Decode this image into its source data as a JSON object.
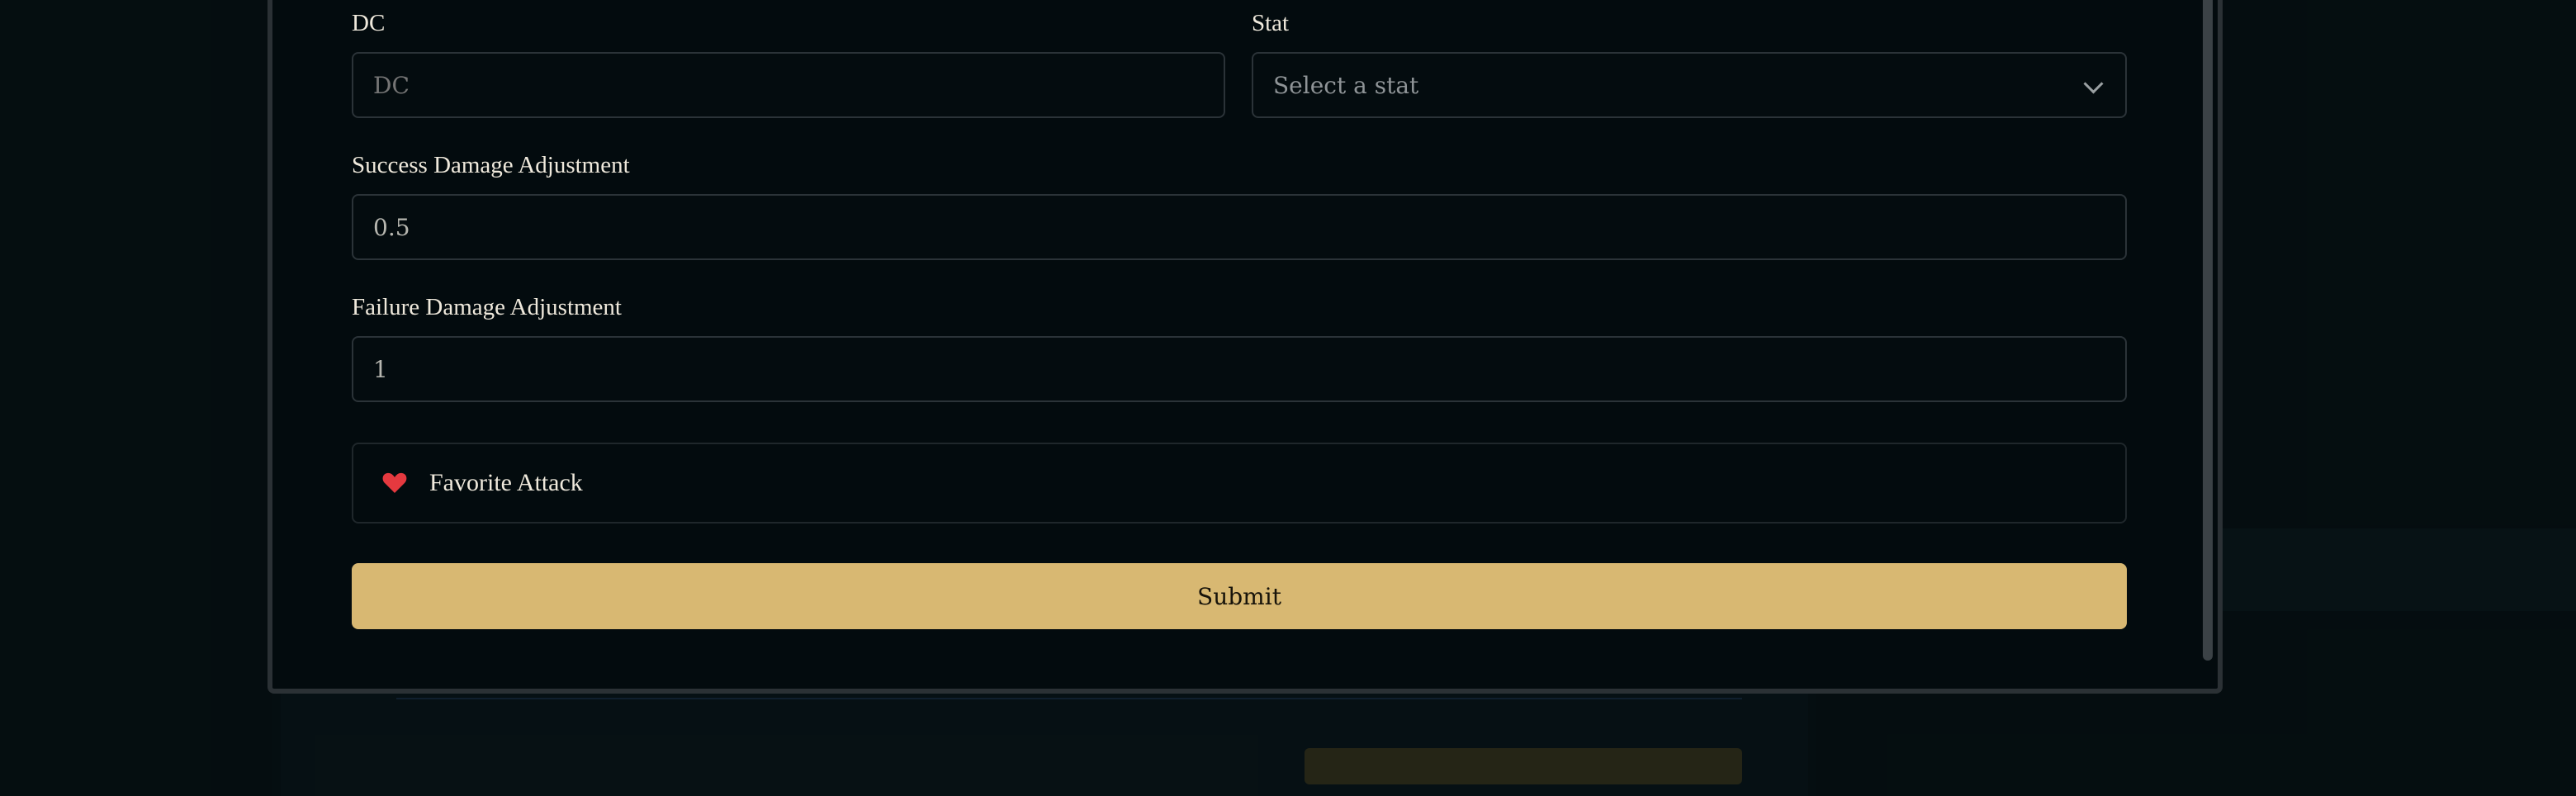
{
  "form": {
    "dc": {
      "label": "DC",
      "placeholder": "DC"
    },
    "stat": {
      "label": "Stat",
      "selected": "Select a stat"
    },
    "success_damage": {
      "label": "Success Damage Adjustment",
      "value": "0.5"
    },
    "failure_damage": {
      "label": "Failure Damage Adjustment",
      "value": "1"
    },
    "favorite": {
      "label": "Favorite Attack",
      "icon": "heart-icon",
      "color": "#e5393f"
    },
    "submit_label": "Submit"
  },
  "colors": {
    "accent": "#d8b872",
    "modal_bg": "#030b0e",
    "page_bg": "#08161b"
  }
}
